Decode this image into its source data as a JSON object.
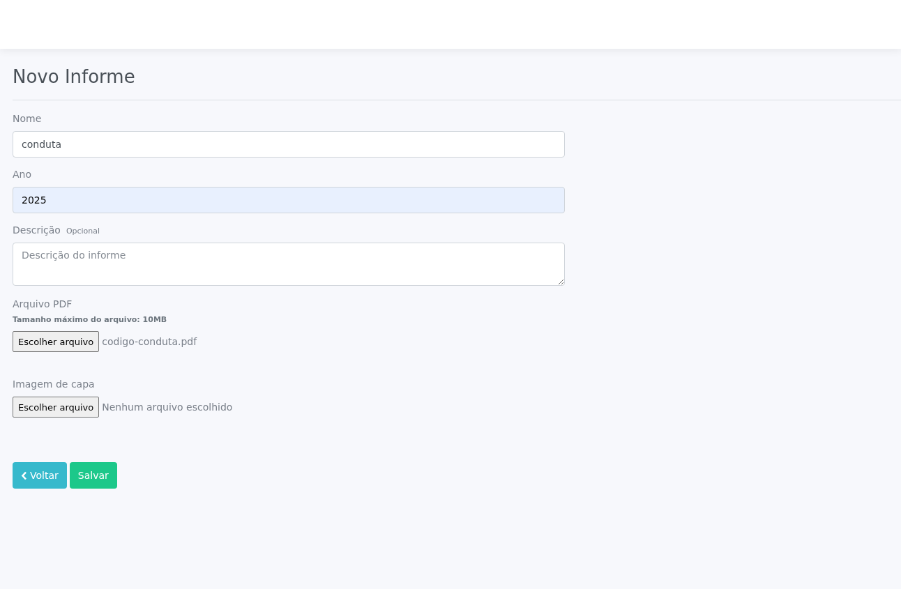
{
  "page_title": "Novo Informe",
  "fields": [
    {
      "kind": "text",
      "label": "Nome",
      "value": "conduta",
      "autofilled": false
    },
    {
      "kind": "text",
      "label": "Ano",
      "value": "2025",
      "autofilled": true
    },
    {
      "kind": "textarea",
      "label": "Descrição",
      "hint": "Opcional",
      "placeholder": "Descrição do informe"
    },
    {
      "kind": "file",
      "label": "Arquivo PDF",
      "note": "Tamanho máximo do arquivo: 10MB",
      "button": "Escolher arquivo",
      "file_name": "codigo-conduta.pdf"
    },
    {
      "kind": "file",
      "label": "Imagem de capa",
      "button": "Escolher arquivo",
      "file_name": "Nenhum arquivo escolhido"
    }
  ],
  "buttons": [
    {
      "kind": "back",
      "label": "Voltar"
    },
    {
      "kind": "save",
      "label": "Salvar"
    }
  ]
}
